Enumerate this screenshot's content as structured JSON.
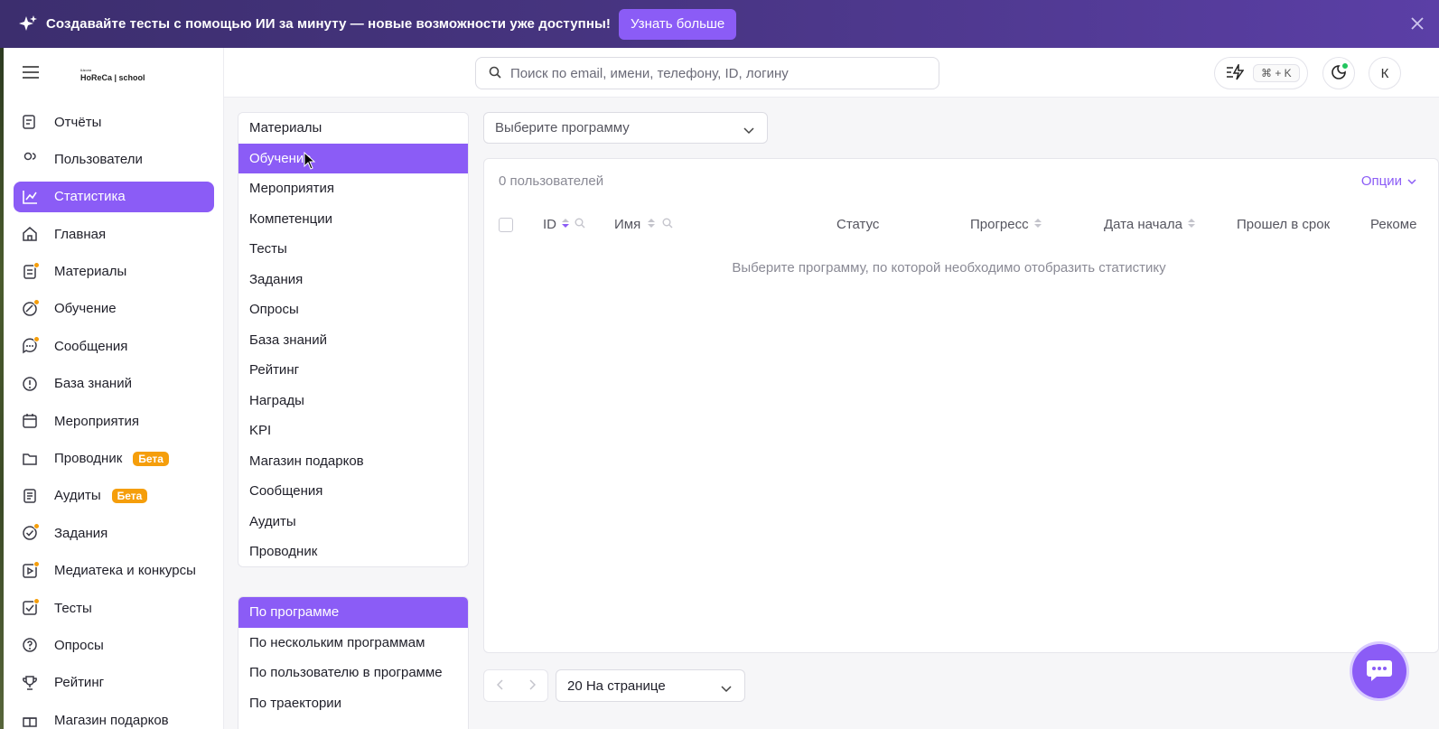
{
  "banner": {
    "text": "Создавайте тесты с помощью ИИ за минуту — новые возможности уже доступны!",
    "button_label": "Узнать больше"
  },
  "logo": {
    "small": "Школа",
    "text": "HoReCa | school"
  },
  "search": {
    "placeholder": "Поиск по email, имени, телефону, ID, логину"
  },
  "header": {
    "shortcut": "⌘ + K",
    "avatar_initial": "К"
  },
  "sidebar": {
    "items": [
      {
        "label": "Отчёты",
        "icon": "report-icon"
      },
      {
        "label": "Пользователи",
        "icon": "users-icon"
      },
      {
        "label": "Статистика",
        "icon": "chart-icon",
        "active": true
      },
      {
        "label": "Главная",
        "icon": "home-icon"
      },
      {
        "label": "Материалы",
        "icon": "materials-icon",
        "dot": true
      },
      {
        "label": "Обучение",
        "icon": "learning-icon",
        "dot": true
      },
      {
        "label": "Сообщения",
        "icon": "messages-icon",
        "dot": true
      },
      {
        "label": "База знаний",
        "icon": "knowledge-icon"
      },
      {
        "label": "Мероприятия",
        "icon": "calendar-icon"
      },
      {
        "label": "Проводник",
        "icon": "folder-icon",
        "badge": "Бета"
      },
      {
        "label": "Аудиты",
        "icon": "audit-icon",
        "badge": "Бета"
      },
      {
        "label": "Задания",
        "icon": "tasks-icon",
        "dot": true
      },
      {
        "label": "Медиатека и конкурсы",
        "icon": "media-icon",
        "dot": true
      },
      {
        "label": "Тесты",
        "icon": "tests-icon",
        "dot": true
      },
      {
        "label": "Опросы",
        "icon": "survey-icon"
      },
      {
        "label": "Рейтинг",
        "icon": "trophy-icon"
      },
      {
        "label": "Магазин подарков",
        "icon": "gift-icon"
      }
    ]
  },
  "stats_menu": {
    "items": [
      "Материалы",
      "Обучение",
      "Мероприятия",
      "Компетенции",
      "Тесты",
      "Задания",
      "Опросы",
      "База знаний",
      "Рейтинг",
      "Награды",
      "KPI",
      "Магазин подарков",
      "Сообщения",
      "Аудиты",
      "Проводник"
    ],
    "active_index": 1
  },
  "report_menu": {
    "items": [
      "По программе",
      "По нескольким программам",
      "По пользователю в программе",
      "По траектории"
    ],
    "active_index": 0
  },
  "program_select": {
    "placeholder": "Выберите программу"
  },
  "table": {
    "count": "0 пользователей",
    "options_label": "Опции",
    "columns": [
      "ID",
      "Имя",
      "Статус",
      "Прогресс",
      "Дата начала",
      "Прошел в срок",
      "Рекоме"
    ],
    "empty_text": "Выберите программу, по которой необходимо отобразить статистику"
  },
  "pagination": {
    "per_page": "20 На странице"
  },
  "colors": {
    "accent": "#8b5cf6",
    "badge": "#f59e0b",
    "banner": "#46347f"
  }
}
